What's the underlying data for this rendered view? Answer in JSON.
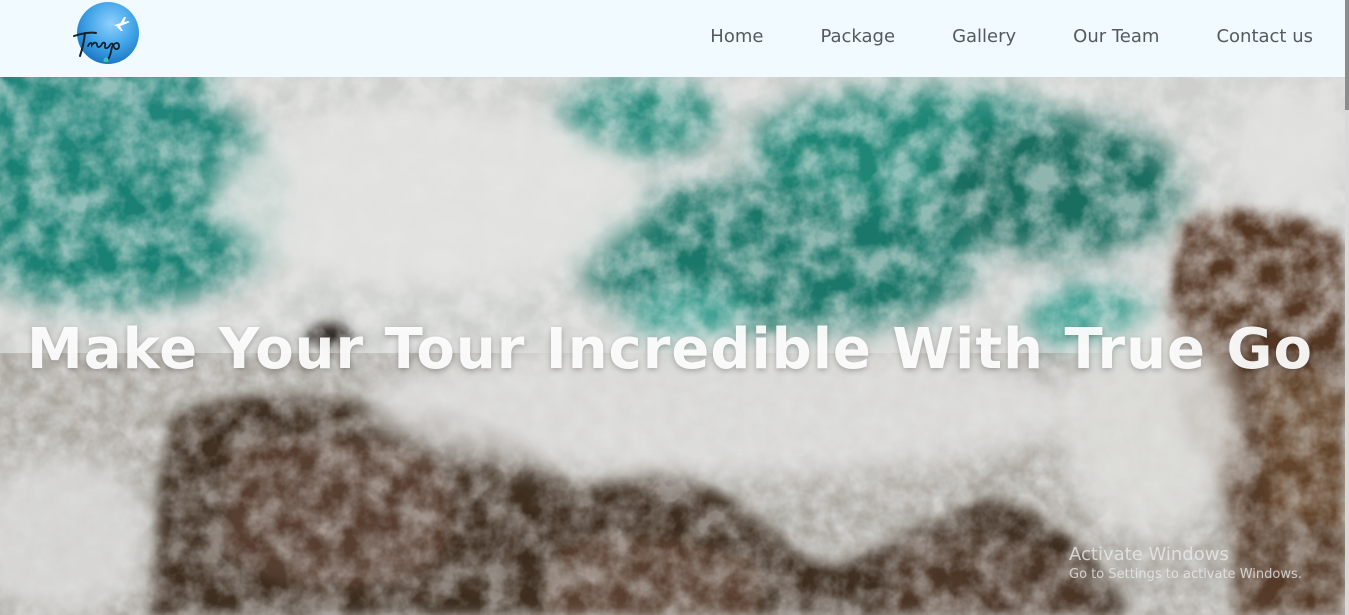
{
  "brand": {
    "logo_text": "Truego",
    "logo_icon": "airplane-icon"
  },
  "nav": {
    "items": [
      {
        "label": "Home"
      },
      {
        "label": "Package"
      },
      {
        "label": "Gallery"
      },
      {
        "label": "Our Team"
      },
      {
        "label": "Contact us"
      }
    ]
  },
  "hero": {
    "title": "Make Your Tour Incredible With True Go",
    "background": "aerial-ocean-waves-on-rocks-image"
  },
  "watermark": {
    "title": "Activate Windows",
    "subtitle": "Go to Settings to activate Windows."
  },
  "colors": {
    "navbar_bg": "#f0faff",
    "nav_text": "#555a5e",
    "logo_blue": "#3fa3e6"
  }
}
